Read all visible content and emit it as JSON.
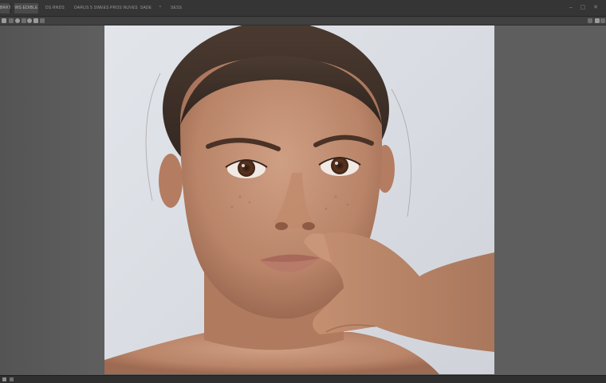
{
  "tabs": [
    {
      "label": "BRKT"
    },
    {
      "label": "WS EDIBLE"
    },
    {
      "label": "DS RNDS"
    },
    {
      "label": "DARUS 5 SWEES"
    },
    {
      "label": "PROS NUVES"
    },
    {
      "label": "SADE"
    },
    {
      "label": "*"
    },
    {
      "label": "SESS"
    }
  ],
  "window_controls": {
    "minimize": "–",
    "maximize": "▢",
    "close": "✕"
  },
  "canvas": {
    "photo_description_icon": "portrait-photo",
    "colors": {
      "workspace": "#5d5d5d",
      "document_background": "#dfe2e7",
      "tab_bar": "#353535"
    }
  },
  "status_bar": {
    "zoom_icon": "zoom-icon"
  }
}
